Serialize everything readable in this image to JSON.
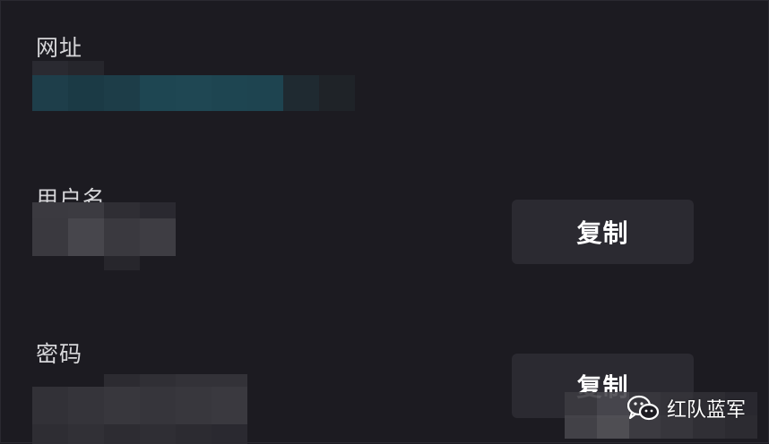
{
  "fields": {
    "url_label": "网址",
    "username_label": "用户名",
    "password_label": "密码"
  },
  "buttons": {
    "copy_username": "复制",
    "copy_password": "复制"
  },
  "watermark": {
    "text": "红队蓝军",
    "icon": "wechat-icon"
  },
  "colors": {
    "background": "#1c1b21",
    "button_bg": "#2b2a31",
    "url_redaction": "#1d4550"
  }
}
